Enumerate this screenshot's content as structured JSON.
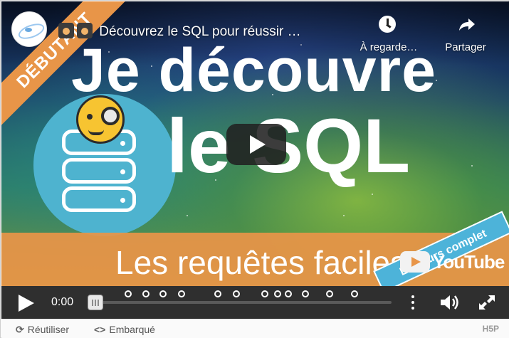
{
  "video": {
    "title": "Découvrez le SQL pour réussir …",
    "badge_corner": "DÉBUTANT",
    "thumbnail_line1": "Je découvre",
    "thumbnail_line2": "le SQL",
    "thumbnail_subtitle": "Les requêtes faciles",
    "ribbon_text": "Le cours complet",
    "youtube_logo_text": "YouTube",
    "watch_later_label": "À regarde…",
    "share_label": "Partager"
  },
  "controls": {
    "time": "0:00",
    "progress": 0,
    "chapter_marker_count": 12
  },
  "footer": {
    "reuse_label": "Réutiliser",
    "embed_label": "Embarqué",
    "embed_icon": "<>",
    "brand": "H5P"
  },
  "icons": {
    "watch_later": "clock-icon",
    "share": "share-arrow-icon",
    "play": "play-icon",
    "menu": "vertical-dots-icon",
    "volume": "volume-icon",
    "fullscreen": "fullscreen-icon",
    "reuse": "reuse-arrows-icon"
  },
  "colors": {
    "accent_orange": "#e89548",
    "db_blue": "#4eb3cf",
    "control_bar": "#2f2f2f"
  }
}
